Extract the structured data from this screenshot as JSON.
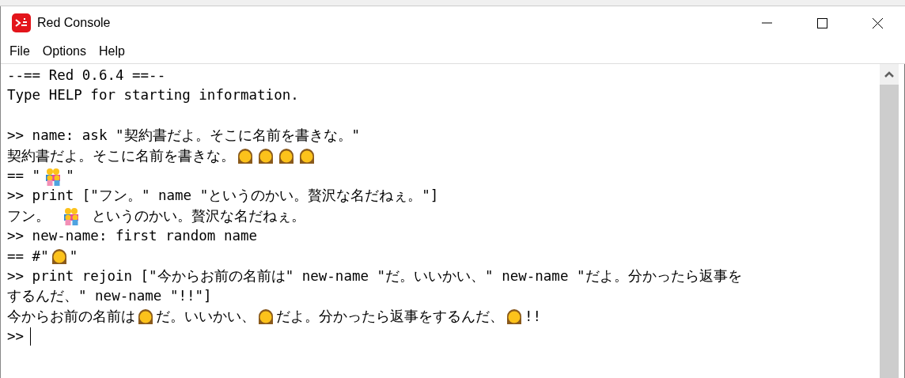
{
  "window": {
    "title": "Red Console"
  },
  "menu": [
    "File",
    "Options",
    "Help"
  ],
  "console": {
    "lines": [
      {
        "kind": "line",
        "segments": [
          {
            "kind": "text",
            "text": "--== Red 0.6.4 ==--"
          }
        ]
      },
      {
        "kind": "line",
        "segments": [
          {
            "kind": "text",
            "text": "Type HELP for starting information."
          }
        ]
      },
      {
        "kind": "blank"
      },
      {
        "kind": "line",
        "segments": [
          {
            "kind": "text",
            "text": ">> name: ask \"契約書だよ。そこに名前を書きな。\""
          }
        ]
      },
      {
        "kind": "line",
        "segments": [
          {
            "kind": "text",
            "text": "契約書だよ。そこに名前を書きな。"
          },
          {
            "kind": "person"
          },
          {
            "kind": "person"
          },
          {
            "kind": "person"
          },
          {
            "kind": "person"
          }
        ]
      },
      {
        "kind": "line",
        "segments": [
          {
            "kind": "text",
            "text": "== \""
          },
          {
            "kind": "family"
          },
          {
            "kind": "text",
            "text": "\""
          }
        ]
      },
      {
        "kind": "line",
        "segments": [
          {
            "kind": "text",
            "text": ">> print [\"フン。\" name \"というのかい。贅沢な名だねぇ。\"]"
          }
        ]
      },
      {
        "kind": "line",
        "segments": [
          {
            "kind": "text",
            "text": "フン。 "
          },
          {
            "kind": "family"
          },
          {
            "kind": "text",
            "text": " というのかい。贅沢な名だねぇ。"
          }
        ]
      },
      {
        "kind": "line",
        "segments": [
          {
            "kind": "text",
            "text": ">> new-name: first random name"
          }
        ]
      },
      {
        "kind": "line",
        "segments": [
          {
            "kind": "text",
            "text": "== #\""
          },
          {
            "kind": "person"
          },
          {
            "kind": "text",
            "text": "\""
          }
        ]
      },
      {
        "kind": "line",
        "segments": [
          {
            "kind": "text",
            "text": ">> print rejoin [\"今からお前の名前は\" new-name \"だ。いいかい、\" new-name \"だよ。分かったら返事を"
          }
        ]
      },
      {
        "kind": "line",
        "segments": [
          {
            "kind": "text",
            "text": "するんだ、\" new-name \"!!\"]"
          }
        ]
      },
      {
        "kind": "line",
        "segments": [
          {
            "kind": "text",
            "text": "今からお前の名前は"
          },
          {
            "kind": "person"
          },
          {
            "kind": "text",
            "text": "だ。いいかい、"
          },
          {
            "kind": "person"
          },
          {
            "kind": "text",
            "text": "だよ。分かったら返事をするんだ、"
          },
          {
            "kind": "person"
          },
          {
            "kind": "text",
            "text": "!!"
          }
        ]
      },
      {
        "kind": "line",
        "segments": [
          {
            "kind": "text",
            "text": ">>"
          },
          {
            "kind": "caret"
          }
        ]
      }
    ]
  }
}
